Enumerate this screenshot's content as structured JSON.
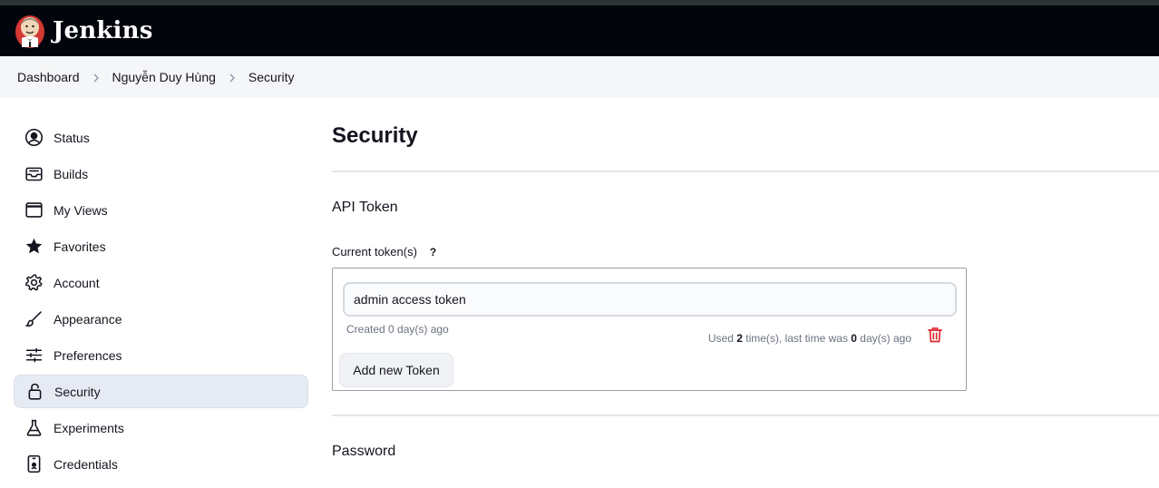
{
  "header": {
    "brand": "Jenkins",
    "logo_icon": "jenkins-butler-icon"
  },
  "breadcrumbs": [
    "Dashboard",
    "Nguyễn Duy Hùng",
    "Security"
  ],
  "sidebar": {
    "items": [
      {
        "label": "Status",
        "icon": "user-circle-icon"
      },
      {
        "label": "Builds",
        "icon": "inbox-icon"
      },
      {
        "label": "My Views",
        "icon": "window-icon"
      },
      {
        "label": "Favorites",
        "icon": "star-icon"
      },
      {
        "label": "Account",
        "icon": "gear-icon"
      },
      {
        "label": "Appearance",
        "icon": "brush-icon"
      },
      {
        "label": "Preferences",
        "icon": "sliders-icon"
      },
      {
        "label": "Security",
        "icon": "lock-icon",
        "active": true
      },
      {
        "label": "Experiments",
        "icon": "flask-icon"
      },
      {
        "label": "Credentials",
        "icon": "id-card-icon"
      }
    ]
  },
  "main": {
    "title": "Security",
    "api_section": "API Token",
    "current_tokens_label": "Current token(s)",
    "help": "?",
    "token": {
      "name": "admin access token",
      "created": "Created 0 day(s) ago",
      "used_prefix": "Used ",
      "used_count": "2",
      "used_mid": " time(s), last time was ",
      "used_days": "0",
      "used_suffix": " day(s) ago"
    },
    "add_button": "Add new Token",
    "password_section": "Password"
  },
  "colors": {
    "header_bg": "#03050d",
    "breadcrumb_bg": "#f5f6f8",
    "active_item_bg": "#e6ebf3",
    "delete_red": "#e0282e"
  }
}
